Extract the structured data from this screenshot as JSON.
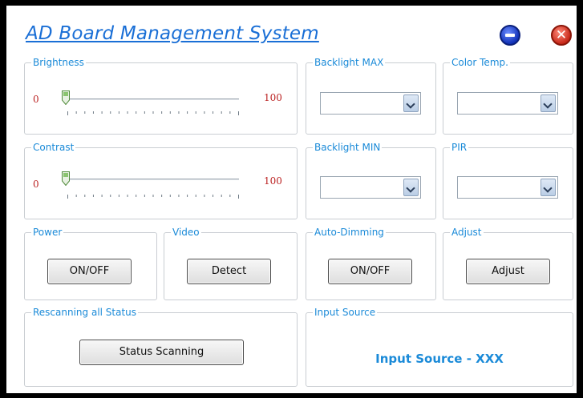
{
  "window": {
    "title": "AD Board Management System"
  },
  "brightness": {
    "label": "Brightness",
    "min": "0",
    "max": "100",
    "value": 0
  },
  "contrast": {
    "label": "Contrast",
    "min": "0",
    "max": "100",
    "value": 0
  },
  "backlight_max": {
    "label": "Backlight MAX",
    "selected": ""
  },
  "color_temp": {
    "label": "Color Temp.",
    "selected": ""
  },
  "backlight_min": {
    "label": "Backlight MIN",
    "selected": ""
  },
  "pir": {
    "label": "PIR",
    "selected": ""
  },
  "power": {
    "label": "Power",
    "button": "ON/OFF"
  },
  "video": {
    "label": "Video",
    "button": "Detect"
  },
  "auto_dimming": {
    "label": "Auto-Dimming",
    "button": "ON/OFF"
  },
  "adjust": {
    "label": "Adjust",
    "button": "Adjust"
  },
  "rescan": {
    "label": "Rescanning all Status",
    "button": "Status Scanning"
  },
  "input_source": {
    "label": "Input Source",
    "value": "Input Source - XXX"
  },
  "icons": {
    "minimize": "minus-circle-icon",
    "close": "x-circle-icon"
  },
  "colors": {
    "accent": "#1a8ad8",
    "title": "#1a6fd6",
    "minmax": "#b22222"
  }
}
